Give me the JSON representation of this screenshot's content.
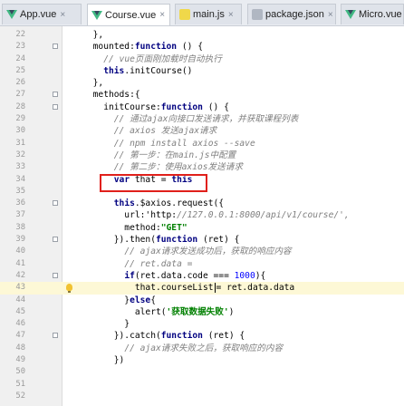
{
  "tabs": [
    {
      "label": "App.vue",
      "icon": "vue-file-icon"
    },
    {
      "label": "Course.vue",
      "icon": "vue-file-icon",
      "active": true
    },
    {
      "label": "main.js",
      "icon": "js-file-icon"
    },
    {
      "label": "package.json",
      "icon": "json-file-icon"
    },
    {
      "label": "Micro.vue",
      "icon": "vue-file-icon"
    }
  ],
  "close_glyph": "×",
  "editor": {
    "current_line": 43,
    "lines": [
      {
        "n": "22",
        "t": "      },"
      },
      {
        "n": "23",
        "t": "      mounted:function () {"
      },
      {
        "n": "24",
        "t": "        // vue页面刚加载时自动执行"
      },
      {
        "n": "25",
        "t": "        this.initCourse()"
      },
      {
        "n": "26",
        "t": "      },"
      },
      {
        "n": "27",
        "t": "      methods:{"
      },
      {
        "n": "28",
        "t": "        initCourse:function () {"
      },
      {
        "n": "29",
        "t": "          // 通过ajax向接口发送请求，并获取课程列表"
      },
      {
        "n": "30",
        "t": "          // axios 发送ajax请求"
      },
      {
        "n": "31",
        "t": "          // npm install axios --save"
      },
      {
        "n": "32",
        "t": "          // 第一步：在main.js中配置"
      },
      {
        "n": "33",
        "t": "          // 第二步：使用axios发送请求"
      },
      {
        "n": "34",
        "t": "          var that = this"
      },
      {
        "n": "35",
        "t": ""
      },
      {
        "n": "36",
        "t": "          this.$axios.request({"
      },
      {
        "n": "37",
        "t": "            url:'http://127.0.0.1:8000/api/v1/course/',"
      },
      {
        "n": "38",
        "t": "            method:\"GET\""
      },
      {
        "n": "39",
        "t": "          }).then(function (ret) {"
      },
      {
        "n": "40",
        "t": "            // ajax请求发送成功后，获取的响应内容"
      },
      {
        "n": "41",
        "t": "            // ret.data ="
      },
      {
        "n": "42",
        "t": "            if(ret.data.code === 1000){"
      },
      {
        "n": "43",
        "t": "              that.courseList = ret.data.data"
      },
      {
        "n": "44",
        "t": "            }else{"
      },
      {
        "n": "45",
        "t": "              alert('获取数据失败')"
      },
      {
        "n": "46",
        "t": "            }"
      },
      {
        "n": "47",
        "t": "          }).catch(function (ret) {"
      },
      {
        "n": "48",
        "t": "            // ajax请求失败之后，获取响应的内容"
      },
      {
        "n": "49",
        "t": "          })"
      },
      {
        "n": "50",
        "t": ""
      },
      {
        "n": "51",
        "t": ""
      },
      {
        "n": "52",
        "t": ""
      }
    ]
  }
}
